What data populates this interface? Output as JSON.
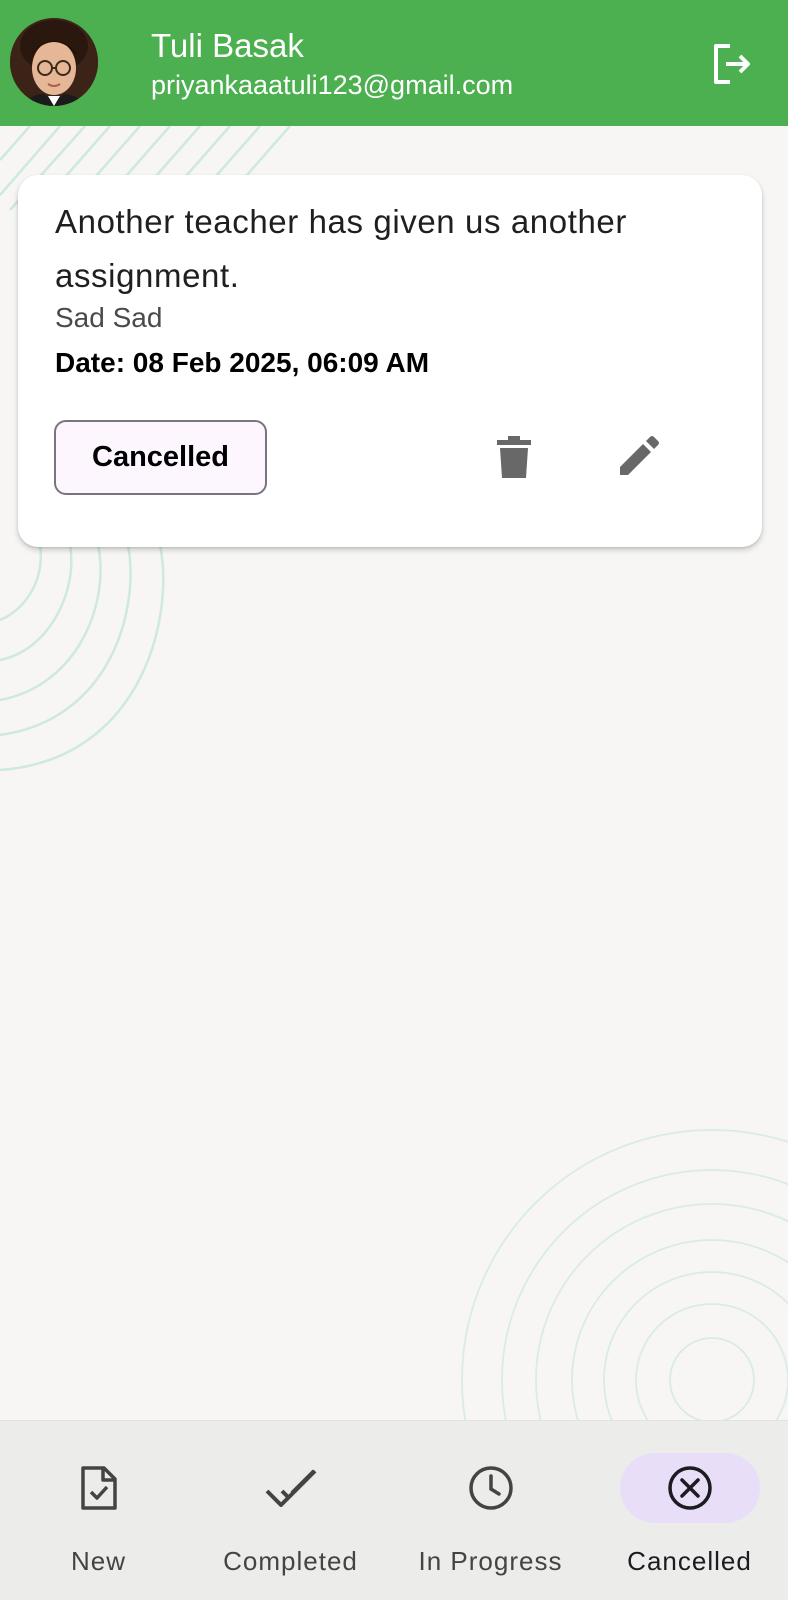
{
  "header": {
    "user_name": "Tuli Basak",
    "user_email": "priyankaaatuli123@gmail.com",
    "background_color": "#4caf50",
    "avatar_icon": "user-avatar-photo",
    "logout_icon": "logout-icon"
  },
  "task": {
    "title": "Another teacher has given us another assignment.",
    "description": "Sad Sad",
    "date": "Date: 08 Feb 2025, 06:09 AM",
    "status": "Cancelled",
    "delete_icon": "trash-icon",
    "edit_icon": "pencil-icon"
  },
  "bottom_nav": {
    "items": [
      {
        "label": "New",
        "icon": "document-check-icon",
        "active": false
      },
      {
        "label": "Completed",
        "icon": "double-check-icon",
        "active": false
      },
      {
        "label": "In Progress",
        "icon": "clock-icon",
        "active": false
      },
      {
        "label": "Cancelled",
        "icon": "circle-x-icon",
        "active": true
      }
    ],
    "active_color": "#e8def8"
  }
}
